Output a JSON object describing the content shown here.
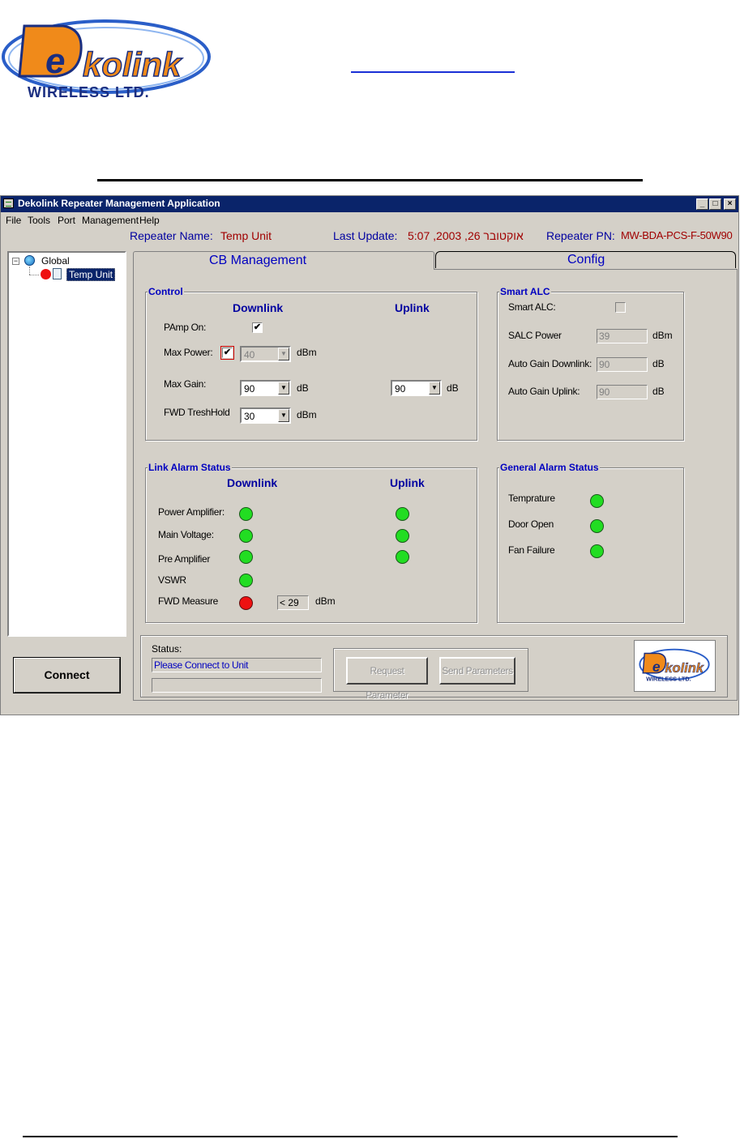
{
  "logo": {
    "brand": "Dekolink",
    "sub": "WIRELESS LTD."
  },
  "window": {
    "title": "Dekolink Repeater Management Application",
    "controls": {
      "minimize": "_",
      "maximize": "□",
      "close": "×"
    },
    "menu": [
      "File",
      "Tools",
      "Port",
      "Management",
      "Help"
    ]
  },
  "info": {
    "repeater_name_label": "Repeater Name:",
    "repeater_name": "Temp Unit",
    "last_update_label": "Last Update:",
    "last_update": "5:07 ,2003 ,26 אוקטובר",
    "repeater_pn_label": "Repeater PN:",
    "repeater_pn": "MW-BDA-PCS-F-50W90"
  },
  "tree": {
    "expand": "−",
    "root": "Global",
    "child": "Temp Unit"
  },
  "connect_label": "Connect",
  "tabs": {
    "active": "CB Management",
    "other": "Config"
  },
  "control": {
    "title": "Control",
    "downlink": "Downlink",
    "uplink": "Uplink",
    "pamp_label": "PAmp On:",
    "pamp_check": "✔",
    "max_power_label": "Max Power:",
    "max_power_check": "✔",
    "max_power_value": "40",
    "max_power_unit": "dBm",
    "max_gain_label": "Max Gain:",
    "max_gain_dl": "90",
    "max_gain_dl_unit": "dB",
    "max_gain_ul": "90",
    "max_gain_ul_unit": "dB",
    "fwd_label": "FWD TreshHold",
    "fwd_value": "30",
    "fwd_unit": "dBm",
    "arrow": "▼"
  },
  "smart_alc": {
    "title": "Smart ALC",
    "smart_label": "Smart ALC:",
    "salc_power_label": "SALC Power",
    "salc_power_value": "39",
    "salc_power_unit": "dBm",
    "agc_dl_label": "Auto Gain Downlink:",
    "agc_dl_value": "90",
    "agc_dl_unit": "dB",
    "agc_ul_label": "Auto Gain Uplink:",
    "agc_ul_value": "90",
    "agc_ul_unit": "dB"
  },
  "link_alarm": {
    "title": "Link Alarm Status",
    "downlink": "Downlink",
    "uplink": "Uplink",
    "power_amp": "Power Amplifier:",
    "main_voltage": "Main Voltage:",
    "pre_amp": "Pre Amplifier",
    "vswr": "VSWR",
    "fwd_measure": "FWD Measure",
    "fwd_measure_value": "< 29",
    "fwd_measure_unit": "dBm"
  },
  "general_alarm": {
    "title": "General Alarm Status",
    "temprature": "Temprature",
    "door_open": "Door Open",
    "fan_failure": "Fan Failure"
  },
  "status": {
    "label": "Status:",
    "message": "Please Connect to Unit",
    "request_btn": "Request Parameter",
    "send_btn": "Send  Parameters"
  },
  "colors": {
    "led_ok": "#22dd22",
    "led_alarm": "#ee1111",
    "titlebar": "#0a246a"
  }
}
